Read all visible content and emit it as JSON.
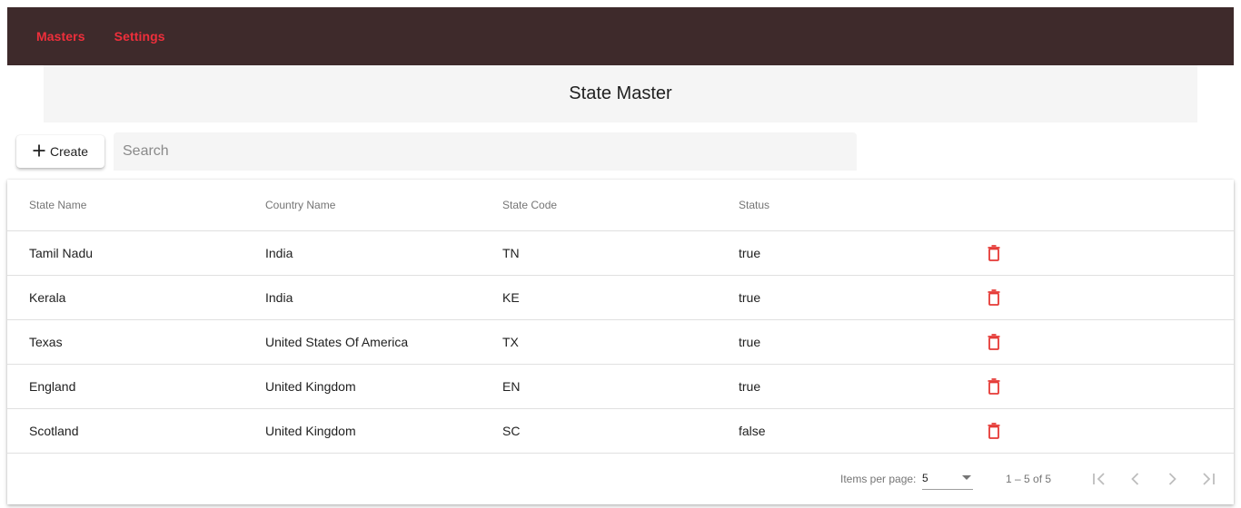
{
  "nav": {
    "items": [
      {
        "label": "Masters"
      },
      {
        "label": "Settings"
      }
    ]
  },
  "page": {
    "title": "State Master"
  },
  "toolbar": {
    "create_label": "Create",
    "create_icon": "plus-icon",
    "search_placeholder": "Search",
    "search_value": ""
  },
  "table": {
    "headers": [
      "State Name",
      "Country Name",
      "State Code",
      "Status"
    ],
    "rows": [
      {
        "state": "Tamil Nadu",
        "country": "India",
        "code": "TN",
        "status": "true"
      },
      {
        "state": "Kerala",
        "country": "India",
        "code": "KE",
        "status": "true"
      },
      {
        "state": "Texas",
        "country": "United States Of America",
        "code": "TX",
        "status": "true"
      },
      {
        "state": "England",
        "country": "United Kingdom",
        "code": "EN",
        "status": "true"
      },
      {
        "state": "Scotland",
        "country": "United Kingdom",
        "code": "SC",
        "status": "false"
      }
    ],
    "row_action_icon": "delete-icon"
  },
  "paginator": {
    "items_per_page_label": "Items per page:",
    "items_per_page_value": "5",
    "range_label": "1 – 5 of 5",
    "icons": [
      "first-page-icon",
      "previous-page-icon",
      "next-page-icon",
      "last-page-icon"
    ]
  },
  "colors": {
    "topbar": "#3e2a2b",
    "nav_link": "#ee2f3b",
    "delete_icon": "#e53935",
    "title_bar": "#f5f5f5"
  }
}
